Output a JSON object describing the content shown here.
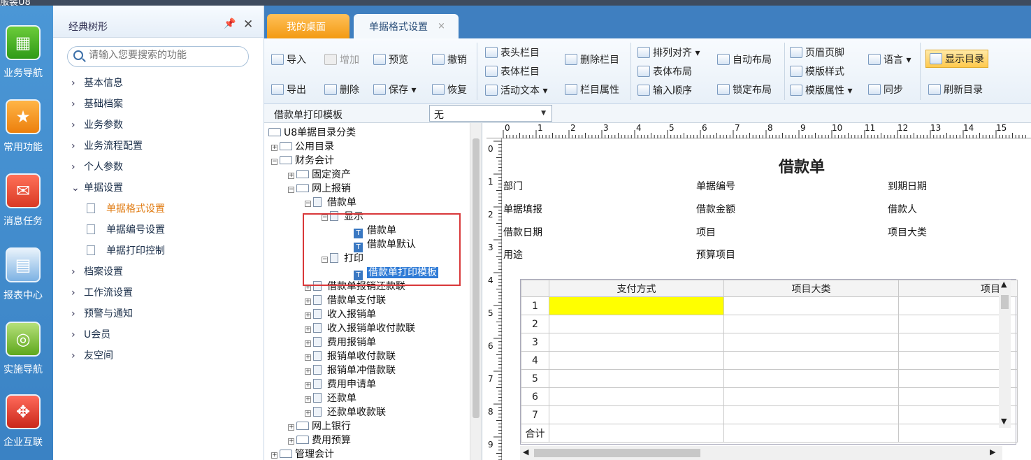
{
  "window": {
    "title_fragment": "服装U8"
  },
  "leftnav": [
    {
      "label": "业务导航",
      "icon": "business-nav-icon",
      "color": "green"
    },
    {
      "label": "常用功能",
      "icon": "star-icon",
      "color": "orange"
    },
    {
      "label": "消息任务",
      "icon": "mail-icon",
      "color": "red"
    },
    {
      "label": "报表中心",
      "icon": "report-icon",
      "color": "blue"
    },
    {
      "label": "实施导航",
      "icon": "compass-icon",
      "color": "lgreen"
    },
    {
      "label": "企业互联",
      "icon": "network-icon",
      "color": "red2"
    }
  ],
  "sidebar": {
    "title": "经典树形",
    "search_placeholder": "请输入您要搜索的功能",
    "items": [
      {
        "label": "基本信息",
        "arrow": "›"
      },
      {
        "label": "基础档案",
        "arrow": "›"
      },
      {
        "label": "业务参数",
        "arrow": "›"
      },
      {
        "label": "业务流程配置",
        "arrow": "›"
      },
      {
        "label": "个人参数",
        "arrow": "›"
      },
      {
        "label": "单据设置",
        "arrow": "⌄"
      }
    ],
    "subitems": [
      {
        "label": "单据格式设置",
        "selected": true
      },
      {
        "label": "单据编号设置",
        "selected": false
      },
      {
        "label": "单据打印控制",
        "selected": false
      }
    ],
    "items2": [
      {
        "label": "档案设置",
        "arrow": "›"
      },
      {
        "label": "工作流设置",
        "arrow": "›"
      },
      {
        "label": "预警与通知",
        "arrow": "›"
      },
      {
        "label": "U会员",
        "arrow": "›"
      },
      {
        "label": "友空间",
        "arrow": "›"
      }
    ]
  },
  "tabs": {
    "desk": "我的桌面",
    "format": "单据格式设置",
    "close": "×"
  },
  "toolbar": {
    "import": "导入",
    "export": "导出",
    "add": "增加",
    "delete": "删除",
    "preview": "预览",
    "save": "保存",
    "undo": "撤销",
    "restore": "恢复",
    "header_col": "表头栏目",
    "body_col": "表体栏目",
    "active_text": "活动文本",
    "del_col": "删除栏目",
    "col_attr": "栏目属性",
    "align": "排列对齐",
    "body_layout": "表体布局",
    "input_order": "输入顺序",
    "auto_layout": "自动布局",
    "lock_layout": "锁定布局",
    "header_footer": "页眉页脚",
    "template_style": "模版样式",
    "template_attr": "模版属性",
    "language": "语言",
    "sync": "同步",
    "show_dir": "显示目录",
    "refresh_dir": "刷新目录"
  },
  "selector": {
    "label": "借款单打印模板",
    "value": "无"
  },
  "tree": [
    "U8单据目录分类",
    "公用目录",
    "财务会计",
    "固定资产",
    "网上报销",
    "借款单",
    "显示",
    "借款单",
    "借款单默认",
    "打印",
    "借款单打印模板",
    "借款单报销还款联",
    "借款单支付联",
    "收入报销单",
    "收入报销单收付款联",
    "费用报销单",
    "报销单收付款联",
    "报销单冲借款联",
    "费用申请单",
    "还款单",
    "还款单收款联",
    "网上银行",
    "费用预算",
    "管理会计"
  ],
  "ruler_top": [
    "0",
    "1",
    "2",
    "3",
    "4",
    "5",
    "6",
    "7",
    "8",
    "9",
    "10",
    "11",
    "12",
    "13",
    "14",
    "15"
  ],
  "ruler_left": [
    "0",
    "1",
    "2",
    "3",
    "4",
    "5",
    "6",
    "7",
    "8",
    "9"
  ],
  "form": {
    "title": "借款单",
    "fields": [
      "部门",
      "单据编号",
      "到期日期",
      "单据填报",
      "借款金额",
      "借款人",
      "借款日期",
      "项目",
      "项目大类",
      "用途",
      "预算项目"
    ]
  },
  "grid": {
    "columns": [
      "支付方式",
      "项目大类",
      "项目"
    ],
    "rows": [
      "1",
      "2",
      "3",
      "4",
      "5",
      "6",
      "7"
    ],
    "total": "合计",
    "highlight_color": "#ffff00"
  }
}
